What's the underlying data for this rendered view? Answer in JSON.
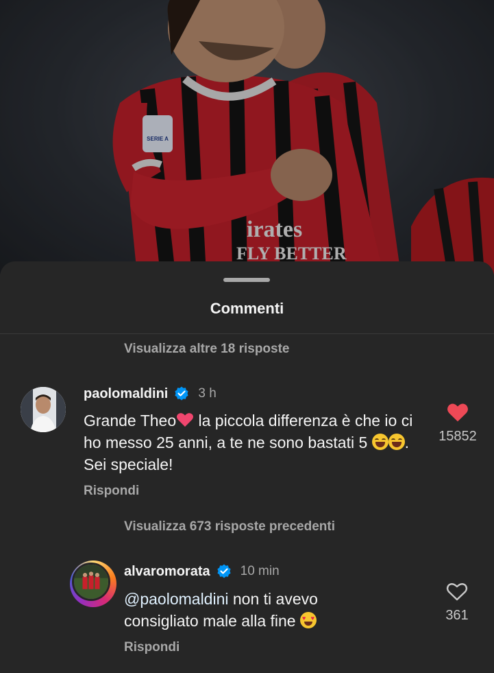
{
  "sheet": {
    "title": "Commenti"
  },
  "thread_top": {
    "view_more_label": "Visualizza altre 18 risposte"
  },
  "comments": [
    {
      "username": "paolomaldini",
      "verified": true,
      "time": "3 h",
      "text_part1": "Grande Theo",
      "text_part2": " la piccola differenza è che io ci ho messo 25 anni, a te ne sono bastati 5 ",
      "text_part3": ". Sei speciale!",
      "reply_label": "Rispondi",
      "like_count": "15852",
      "liked": true
    },
    {
      "username": "alvaromorata",
      "verified": true,
      "time": "10 min",
      "mention": "@paolomaldini",
      "text": " non ti avevo consigliato male alla fine ",
      "reply_label": "Rispondi",
      "like_count": "361",
      "liked": false
    }
  ],
  "replies_toggle": {
    "label": "Visualizza 673 risposte precedenti"
  },
  "photo": {
    "sponsor_line1": "irates",
    "sponsor_line2": "FLY BETTER",
    "badge": "SERIE A"
  },
  "colors": {
    "sheet_bg": "#262626",
    "like_red": "#ed4956",
    "verified_blue": "#0095f6",
    "muted_text": "#a8a8a8"
  },
  "icons": [
    "heart-filled-icon",
    "heart-outline-icon",
    "verified-badge-icon",
    "laughing-emoji-icon",
    "heart-eyes-emoji-icon",
    "red-heart-emoji-icon"
  ]
}
